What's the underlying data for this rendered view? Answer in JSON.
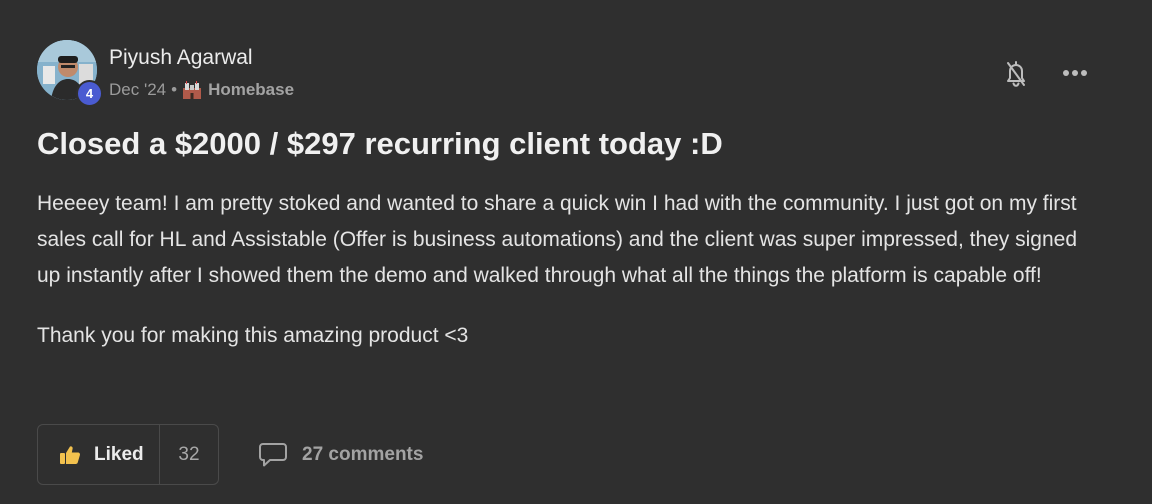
{
  "author": {
    "name": "Piyush Agarwal",
    "level": "4",
    "avatar_icon": "avatar-photo"
  },
  "meta": {
    "date": "Dec '24",
    "separator": "•",
    "space_icon": "castle-icon",
    "space_name": "Homebase"
  },
  "actions": {
    "notify_icon": "bell-off-icon",
    "more_icon": "more-dots-icon"
  },
  "post": {
    "title": "Closed a $2000 / $297 recurring client today :D",
    "paragraphs": [
      "Heeeey team! I am pretty stoked and wanted to share a quick win I had with the community. I just got on my first sales call for HL and Assistable (Offer is business automations) and the client was super impressed, they signed up instantly after I showed them the demo and walked through what all the things the platform is capable off!",
      "Thank you for making this amazing product <3"
    ]
  },
  "footer": {
    "like_label": "Liked",
    "like_count": "32",
    "like_icon": "thumbs-up-icon",
    "comments_label": "27 comments",
    "comments_icon": "comment-icon"
  },
  "colors": {
    "background": "#2f2f2f",
    "level_badge": "#4a5bd1",
    "like_icon": "#f2c14e"
  }
}
